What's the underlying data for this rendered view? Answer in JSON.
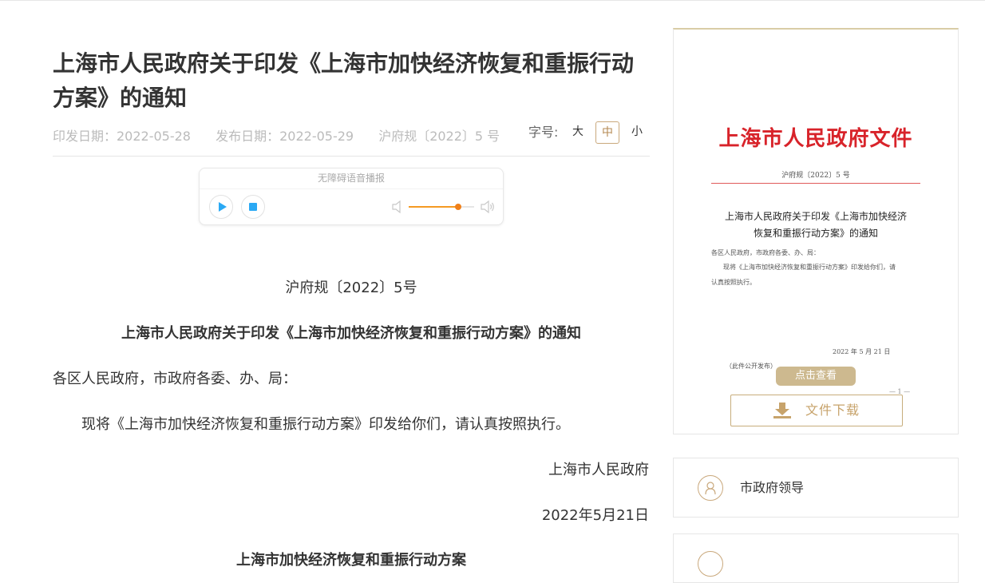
{
  "article": {
    "title": "上海市人民政府关于印发《上海市加快经济恢复和重振行动方案》的通知",
    "meta": {
      "issue_date": "印发日期：2022-05-28",
      "publish_date": "发布日期：2022-05-29",
      "doc_number": "沪府规〔2022〕5 号"
    },
    "font_size": {
      "label": "字号:",
      "large": "大",
      "medium": "中",
      "small": "小",
      "selected": "中"
    },
    "player": {
      "title": "无障碍语音播报",
      "volume_level": 0.75
    },
    "body": {
      "doc_number": "沪府规〔2022〕5号",
      "heading": "上海市人民政府关于印发《上海市加快经济恢复和重振行动方案》的通知",
      "salutation": "各区人民政府，市政府各委、办、局：",
      "paragraph": "现将《上海市加快经济恢复和重振行动方案》印发给你们，请认真按照执行。",
      "signature_org": "上海市人民政府",
      "signature_date": "2022年5月21日",
      "plan_title": "上海市加快经济恢复和重振行动方案"
    }
  },
  "sidebar": {
    "preview": {
      "header": "上海市人民政府文件",
      "number": "沪府规〔2022〕5 号",
      "title_line1": "上海市人民政府关于印发《上海市加快经济",
      "title_line2": "恢复和重振行动方案》的通知",
      "line1": "各区人民政府，市政府各委、办、局：",
      "line2": "现将《上海市加快经济恢复和重振行动方案》印发给你们，请",
      "line3": "认真按照执行。",
      "date": "2022 年 5 月 21 日",
      "publish_note": "（此件公开发布）",
      "page": "— 1 —"
    },
    "view_button": "点击查看",
    "download_button": "文件下载",
    "leaders_link": "市政府领导"
  },
  "colors": {
    "accent_gold": "#c7a36b",
    "header_red": "#d8232a",
    "player_blue": "#2aa9f4",
    "volume_orange": "#f59a23"
  }
}
